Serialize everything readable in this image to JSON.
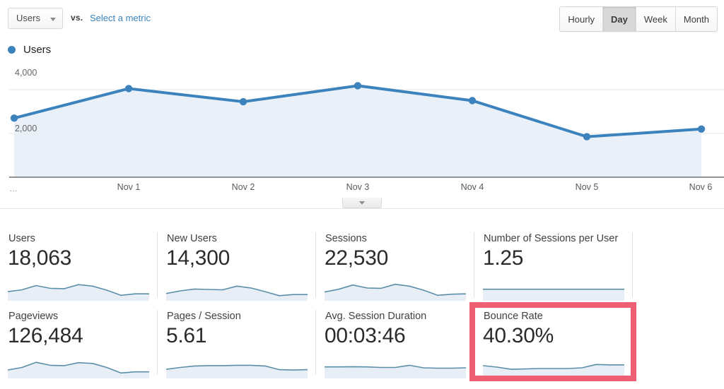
{
  "toolbar": {
    "metric_selector_label": "Users",
    "vs_label": "vs.",
    "compare_link_label": "Select a metric",
    "granularity_options": [
      "Hourly",
      "Day",
      "Week",
      "Month"
    ],
    "granularity_selected": "Day"
  },
  "chart": {
    "legend_label": "Users",
    "legend_color": "#3c83bd",
    "line_color": "#3c83bd",
    "fill_color": "#e9f0f8"
  },
  "chart_data": {
    "type": "line",
    "title": "Users",
    "xlabel": "",
    "ylabel": "Users",
    "categories": [
      "…",
      "Nov 1",
      "Nov 2",
      "Nov 3",
      "Nov 4",
      "Nov 5",
      "Nov 6"
    ],
    "series": [
      {
        "name": "Users",
        "color": "#3c83bd",
        "values": [
          2700,
          4050,
          3450,
          4180,
          3500,
          1850,
          2200
        ]
      }
    ],
    "ylim": [
      0,
      5000
    ],
    "yticks": [
      2000,
      4000
    ],
    "ytick_labels": [
      "2,000",
      "4,000"
    ],
    "grid": true,
    "legend_position": "top-left"
  },
  "collapse_tab": {
    "icon": "chevron-down-icon"
  },
  "cards": {
    "row1": [
      {
        "label": "Users",
        "value": "18,063",
        "spark": [
          0.42,
          0.52,
          0.75,
          0.6,
          0.58,
          0.8,
          0.72,
          0.5,
          0.22,
          0.3,
          0.3
        ]
      },
      {
        "label": "New Users",
        "value": "14,300",
        "spark": [
          0.32,
          0.46,
          0.56,
          0.54,
          0.52,
          0.72,
          0.62,
          0.42,
          0.2,
          0.26,
          0.26
        ]
      },
      {
        "label": "Sessions",
        "value": "22,530",
        "spark": [
          0.4,
          0.55,
          0.78,
          0.62,
          0.6,
          0.82,
          0.72,
          0.5,
          0.22,
          0.28,
          0.3
        ]
      },
      {
        "label": "Number of Sessions per User",
        "value": "1.25",
        "spark": [
          0.55,
          0.55,
          0.55,
          0.55,
          0.55,
          0.55,
          0.55,
          0.55,
          0.55,
          0.55,
          0.55
        ]
      }
    ],
    "row2": [
      {
        "label": "Pageviews",
        "value": "126,484",
        "spark": [
          0.38,
          0.52,
          0.8,
          0.64,
          0.62,
          0.78,
          0.74,
          0.52,
          0.22,
          0.28,
          0.28
        ]
      },
      {
        "label": "Pages / Session",
        "value": "5.61",
        "spark": [
          0.42,
          0.52,
          0.6,
          0.62,
          0.62,
          0.64,
          0.64,
          0.6,
          0.4,
          0.38,
          0.4
        ]
      },
      {
        "label": "Avg. Session Duration",
        "value": "00:03:46",
        "spark": [
          0.55,
          0.55,
          0.56,
          0.55,
          0.52,
          0.52,
          0.64,
          0.5,
          0.48,
          0.48,
          0.5
        ]
      },
      {
        "label": "Bounce Rate",
        "value": "40.30%",
        "spark": [
          0.62,
          0.54,
          0.42,
          0.44,
          0.46,
          0.46,
          0.46,
          0.5,
          0.68,
          0.66,
          0.66
        ],
        "highlighted": true
      }
    ]
  },
  "colors": {
    "accent_blue": "#3c83bd",
    "link_blue": "#3a84bd",
    "spark_line": "#5b8fa8",
    "spark_fill": "#e7eef6",
    "highlight_red": "#ef5f73"
  }
}
